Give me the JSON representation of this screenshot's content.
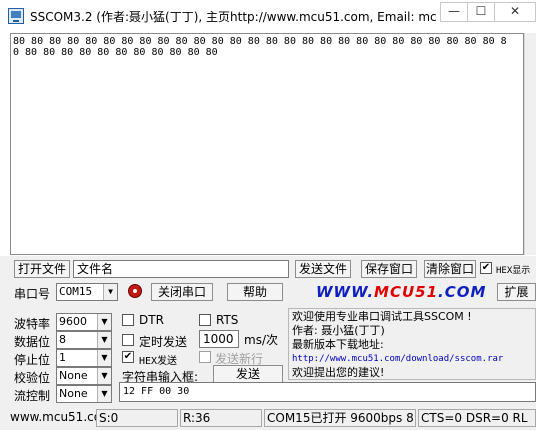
{
  "window": {
    "title": "SSCOM3.2 (作者:聂小猛(丁丁), 主页http://www.mcu51.com,  Email: mc...",
    "minimize_symbol": "—",
    "maximize_symbol": "☐",
    "close_symbol": "✕"
  },
  "receive": {
    "text": "80 80 80 80 80 80 80 80 80 80 80 80 80 80 80 80 80 80 80 80 80 80 80 80 80 80 80 80 80 80 80 80 80 80 80 80 80 80 80"
  },
  "row1": {
    "open_file_label": "打开文件",
    "filename_value": "文件名",
    "send_file_label": "发送文件",
    "save_window_label": "保存窗口",
    "clear_window_label": "清除窗口",
    "hex_display_checked": "✔",
    "hex_display_label": "HEX显示"
  },
  "row2": {
    "port_label": "串口号",
    "port_value": "COM15",
    "close_port_label": "关闭串口",
    "help_label": "帮助",
    "logo_left": "WWW.",
    "logo_mid": "MCU51",
    "logo_right": ".COM",
    "expand_label": "扩展"
  },
  "settings": {
    "baud_label": "波特率",
    "baud_value": "9600",
    "databits_label": "数据位",
    "databits_value": "8",
    "stopbits_label": "停止位",
    "stopbits_value": "1",
    "parity_label": "校验位",
    "parity_value": "None",
    "flow_label": "流控制",
    "flow_value": "None",
    "dropdown_arrow": "▼"
  },
  "options": {
    "dtr_label": "DTR",
    "rts_label": "RTS",
    "timed_send_label": "定时发送",
    "interval_value": "1000",
    "interval_unit": "ms/次",
    "hex_send_checked": "✔",
    "hex_send_label": "HEX发送",
    "send_newline_label": "发送新行",
    "input_box_label": "字符串输入框:",
    "send_label": "发送",
    "send_input_value": "12 FF 00 30"
  },
  "info": {
    "line1": "欢迎使用专业串口调试工具SSCOM !",
    "line2": "作者: 聂小猛(丁丁)",
    "line3": "最新版本下载地址:",
    "line4": "http://www.mcu51.com/download/sscom.rar",
    "line5": "欢迎提出您的建议!"
  },
  "status": {
    "website": "www.mcu51.cor",
    "sent": "S:0",
    "received": "R:36",
    "port_status": "COM15已打开  9600bps  8",
    "signals": "CTS=0 DSR=0 RL"
  }
}
